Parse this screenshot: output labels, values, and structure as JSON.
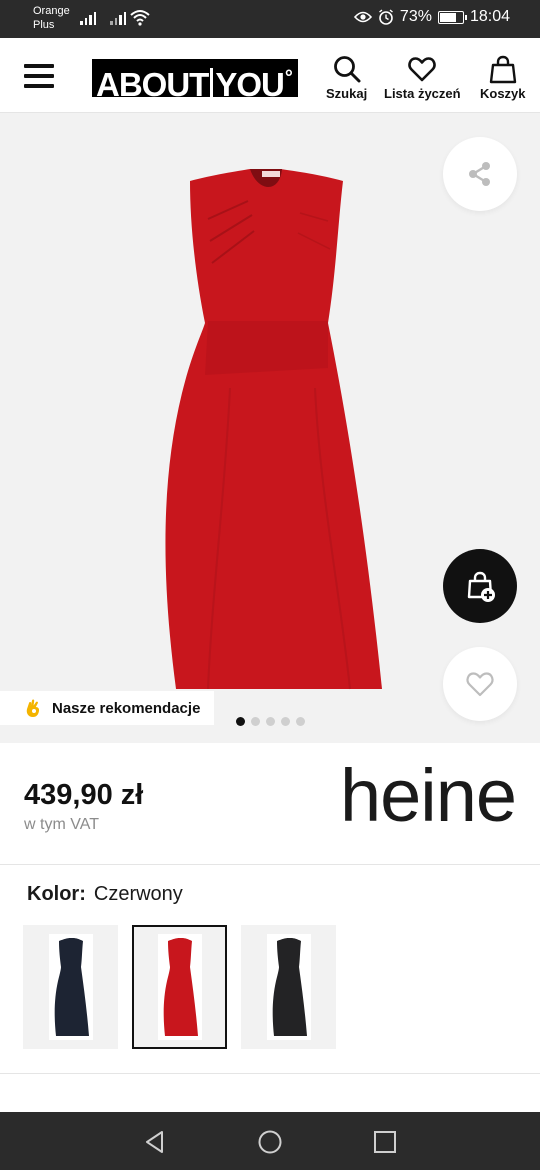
{
  "status_bar": {
    "carrier_line1": "Orange",
    "carrier_line2": "Plus",
    "battery_percent": "73%",
    "battery_level": 0.73,
    "time": "18:04"
  },
  "header": {
    "logo_left": "ABOUT",
    "logo_right": "YOU",
    "search_label": "Szukaj",
    "wishlist_label": "Lista życzeń",
    "cart_label": "Koszyk"
  },
  "gallery": {
    "recommendations_label": "Nasze rekomendacje",
    "image_count": 5,
    "active_index": 0,
    "dress_color": "#c8161d"
  },
  "product": {
    "price": "439,90 zł",
    "vat_note": "w tym VAT",
    "brand": "heine"
  },
  "color": {
    "label": "Kolor:",
    "value": "Czerwony",
    "swatches": [
      {
        "name": "navy",
        "color": "#1d2433",
        "selected": false
      },
      {
        "name": "red",
        "color": "#c8161d",
        "selected": true
      },
      {
        "name": "black",
        "color": "#232325",
        "selected": false
      }
    ]
  },
  "colors": {
    "status_bg": "#2b2b2b",
    "gallery_bg": "#f2f2f2",
    "accent_dark": "#111111"
  }
}
